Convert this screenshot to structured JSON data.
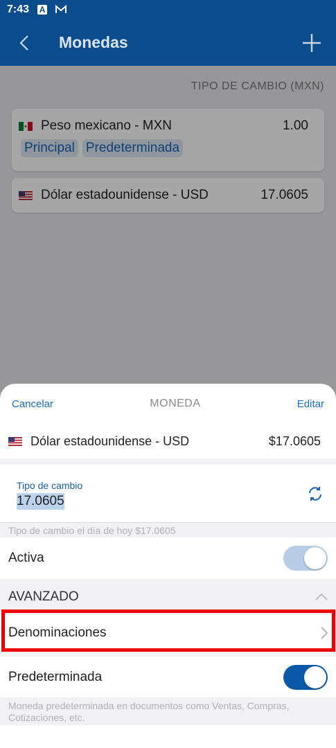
{
  "status_bar": {
    "time": "7:43"
  },
  "app_bar": {
    "title": "Monedas"
  },
  "list": {
    "column_header": "TIPO DE CAMBIO (MXN)",
    "currencies": [
      {
        "name": "Peso mexicano - MXN",
        "rate": "1.00",
        "tags": [
          "Principal",
          "Predeterminada"
        ]
      },
      {
        "name": "Dólar estadounidense - USD",
        "rate": "17.0605"
      }
    ]
  },
  "sheet": {
    "cancel_label": "Cancelar",
    "title": "MONEDA",
    "edit_label": "Editar",
    "currency_name": "Dólar estadounidense - USD",
    "currency_rate": "$17.0605",
    "rate_field_label": "Tipo de cambio",
    "rate_field_value": "17.0605",
    "rate_hint": "Tipo de cambio el día de hoy $17.0605",
    "active_label": "Activa",
    "active_on": true,
    "advanced_label": "AVANZADO",
    "denominations_label": "Denominaciones",
    "default_label": "Predeterminada",
    "default_on": true,
    "default_hint": "Moneda predeterminada en documentos como Ventas, Compras, Cotizaciones, etc."
  },
  "colors": {
    "primary": "#0b4d8c",
    "accent": "#1a6dc0",
    "highlight": "#ee0000"
  }
}
